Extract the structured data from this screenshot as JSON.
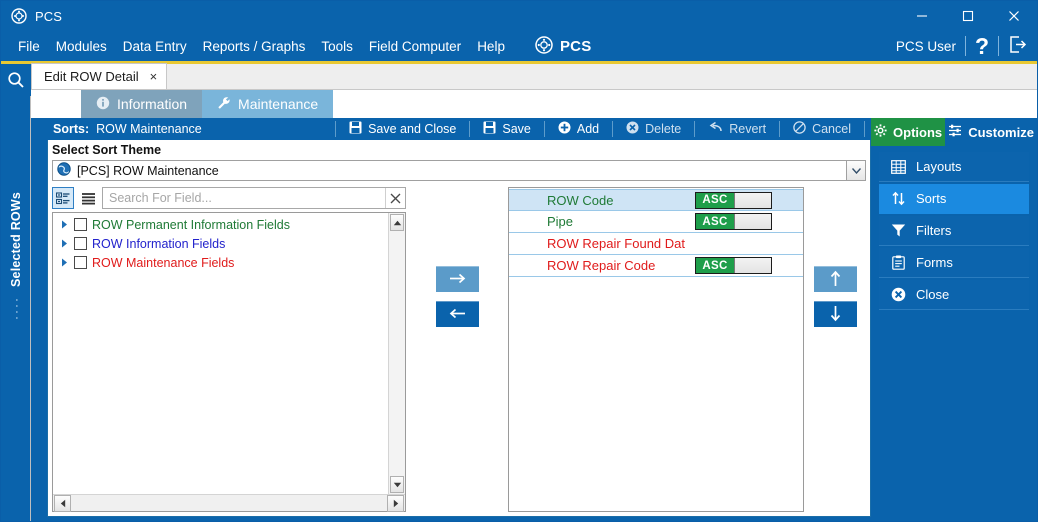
{
  "window": {
    "title": "PCS",
    "app_icon": "pcs-logo-icon",
    "minimize": "minimize-icon",
    "maximize": "maximize-icon",
    "close": "close-icon"
  },
  "menubar": {
    "items": [
      {
        "label": "File"
      },
      {
        "label": "Modules"
      },
      {
        "label": "Data Entry"
      },
      {
        "label": "Reports / Graphs"
      },
      {
        "label": "Tools"
      },
      {
        "label": "Field Computer"
      },
      {
        "label": "Help"
      }
    ],
    "brand": "PCS",
    "user": "PCS User",
    "help_glyph": "?",
    "logout_icon": "logout-icon"
  },
  "left_rail": {
    "search_icon": "search-icon",
    "vertical_label": "Selected ROWs",
    "dots": "····"
  },
  "doc_tab": {
    "label": "Edit ROW Detail",
    "close": "×"
  },
  "section_tabs": [
    {
      "label": "Information",
      "icon": "info-icon",
      "active": false
    },
    {
      "label": "Maintenance",
      "icon": "wrench-icon",
      "active": true
    }
  ],
  "sorts_toolbar": {
    "label": "Sorts:",
    "name": "ROW Maintenance",
    "buttons": [
      {
        "label": "Save and Close",
        "icon": "save-icon"
      },
      {
        "label": "Save",
        "icon": "save-icon"
      },
      {
        "label": "Add",
        "icon": "plus-circle-icon"
      },
      {
        "label": "Delete",
        "icon": "delete-circle-icon"
      },
      {
        "label": "Revert",
        "icon": "undo-icon"
      },
      {
        "label": "Cancel",
        "icon": "cancel-icon"
      }
    ]
  },
  "sort_theme": {
    "label": "Select Sort Theme",
    "icon": "globe-icon",
    "value": "[PCS] ROW Maintenance",
    "chevron": "chevron-down-icon"
  },
  "field_tree": {
    "view_detail_icon": "detail-view-icon",
    "view_list_icon": "list-view-icon",
    "search_placeholder": "Search For Field...",
    "search_value": "",
    "clear_icon": "clear-x-icon",
    "items": [
      {
        "label": "ROW Permanent Information Fields",
        "color": "green"
      },
      {
        "label": "ROW Information Fields",
        "color": "blue"
      },
      {
        "label": "ROW Maintenance Fields",
        "color": "red"
      }
    ],
    "scroll_up": "scroll-up-icon",
    "scroll_down": "scroll-down-icon",
    "scroll_left": "scroll-left-icon",
    "scroll_right": "scroll-right-icon"
  },
  "transfer": {
    "add_icon": "arrow-right-icon",
    "remove_icon": "arrow-left-icon",
    "move_up_icon": "arrow-up-icon",
    "move_down_icon": "arrow-down-icon"
  },
  "sort_rows": [
    {
      "field": "ROW Code",
      "color": "green",
      "direction": "ASC",
      "has_toggle": true,
      "selected": true
    },
    {
      "field": "Pipe",
      "color": "green",
      "direction": "ASC",
      "has_toggle": true,
      "selected": false
    },
    {
      "field": "ROW Repair Found Dat",
      "color": "red",
      "direction": "",
      "has_toggle": false,
      "selected": false
    },
    {
      "field": "ROW Repair Code",
      "color": "red",
      "direction": "ASC",
      "has_toggle": true,
      "selected": false
    }
  ],
  "options_panel": {
    "tabs": [
      {
        "label": "Options",
        "icon": "gear-icon",
        "active": true
      },
      {
        "label": "Customize",
        "icon": "sliders-icon",
        "active": false
      }
    ],
    "items": [
      {
        "label": "Layouts",
        "icon": "grid-icon",
        "active": false
      },
      {
        "label": "Sorts",
        "icon": "sort-arrows-icon",
        "active": true
      },
      {
        "label": "Filters",
        "icon": "funnel-icon",
        "active": false
      },
      {
        "label": "Forms",
        "icon": "clipboard-icon",
        "active": false
      },
      {
        "label": "Close",
        "icon": "close-circle-icon",
        "active": false
      }
    ]
  },
  "colors": {
    "chrome_blue": "#0a63ac",
    "accent_yellow": "#e8c832",
    "green": "#1f9245",
    "highlight_blue": "#1b8ae0",
    "asc_green": "#1e9e4a"
  }
}
